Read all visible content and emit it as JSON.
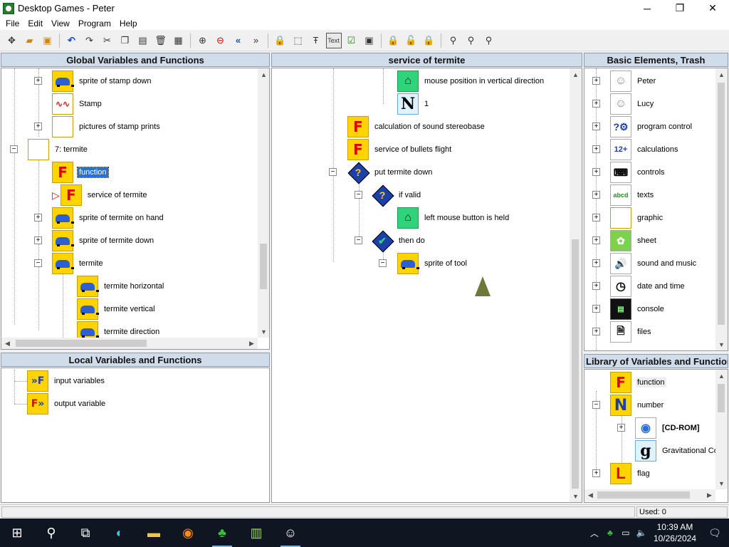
{
  "window": {
    "title": "Desktop Games - Peter",
    "minimize": "─",
    "maximize": "❐",
    "close": "✕"
  },
  "menu": [
    "File",
    "Edit",
    "View",
    "Program",
    "Help"
  ],
  "toolbar": {
    "text_btn": "Text"
  },
  "panels": {
    "global": {
      "title": "Global Variables and Functions",
      "items": [
        {
          "label": "sprite of stamp down",
          "expander": "+"
        },
        {
          "label": "Stamp",
          "expander": ""
        },
        {
          "label": "pictures of stamp prints",
          "expander": "+"
        },
        {
          "label": "7: termite",
          "expander": "−"
        },
        {
          "label": "function",
          "expander": "",
          "selected": true
        },
        {
          "label": "service of termite",
          "expander": ""
        },
        {
          "label": "sprite of termite on hand",
          "expander": "+"
        },
        {
          "label": "sprite of termite down",
          "expander": "+"
        },
        {
          "label": "termite",
          "expander": "−"
        },
        {
          "label": "termite horizontal",
          "expander": ""
        },
        {
          "label": "termite vertical",
          "expander": ""
        },
        {
          "label": "termite direction",
          "expander": ""
        }
      ]
    },
    "local": {
      "title": "Local Variables and Functions",
      "items": [
        {
          "label": "input variables"
        },
        {
          "label": "output variable"
        }
      ]
    },
    "service": {
      "title": "service of termite",
      "items": [
        {
          "label": "mouse position in vertical direction"
        },
        {
          "label": "1"
        },
        {
          "label": "calculation of sound stereobase"
        },
        {
          "label": "service of bullets flight"
        },
        {
          "label": "put termite down",
          "expander": "−"
        },
        {
          "label": "if valid",
          "expander": "−"
        },
        {
          "label": "left mouse button is held"
        },
        {
          "label": "then do",
          "expander": "−"
        },
        {
          "label": "sprite of tool",
          "expander": "−"
        }
      ]
    },
    "basic": {
      "title": "Basic Elements, Trash",
      "items": [
        {
          "label": "Peter"
        },
        {
          "label": "Lucy"
        },
        {
          "label": "program control"
        },
        {
          "label": "calculations"
        },
        {
          "label": "controls"
        },
        {
          "label": "texts"
        },
        {
          "label": "graphic"
        },
        {
          "label": "sheet"
        },
        {
          "label": "sound and music"
        },
        {
          "label": "date and time"
        },
        {
          "label": "console"
        },
        {
          "label": "files"
        }
      ]
    },
    "library": {
      "title": "Library of Variables and Functions",
      "items": [
        {
          "label": "function"
        },
        {
          "label": "number",
          "expander": "−"
        },
        {
          "label": "[CD-ROM]",
          "expander": "+"
        },
        {
          "label": "Gravitational Co"
        },
        {
          "label": "flag",
          "expander": "+"
        }
      ]
    }
  },
  "icons": {
    "N": "N",
    "g": "g",
    "F": "F",
    "L": "L",
    "calc": "12+",
    "abcd": "abcd"
  },
  "status": {
    "used": "Used: 0"
  },
  "taskbar": {
    "time": "10:39 AM",
    "date": "10/26/2024"
  }
}
